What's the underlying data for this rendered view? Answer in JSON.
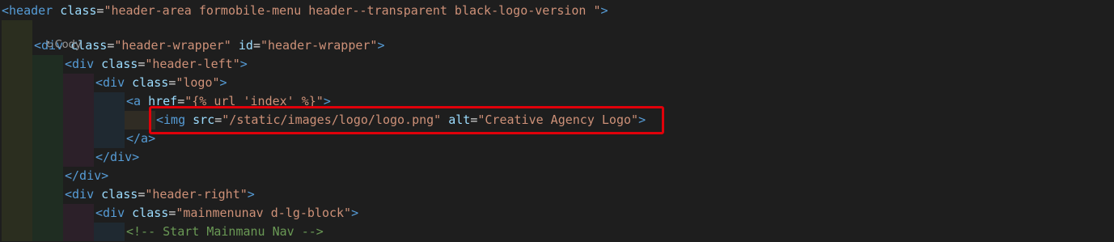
{
  "editor": {
    "code_lens": {
      "icon": "git-author-icon",
      "icon_glyph": "↻",
      "author": "Cody"
    },
    "lines": [
      [
        {
          "t": "tag",
          "v": "<"
        },
        {
          "t": "tag",
          "v": "header"
        },
        {
          "t": "eq",
          "v": " "
        },
        {
          "t": "attr",
          "v": "class"
        },
        {
          "t": "eq",
          "v": "="
        },
        {
          "t": "str",
          "v": "\"header-area formobile-menu header--transparent black-logo-version \""
        },
        {
          "t": "tag",
          "v": ">"
        }
      ],
      [
        {
          "t": "tag",
          "v": "<div"
        },
        {
          "t": "eq",
          "v": " "
        },
        {
          "t": "attr",
          "v": "class"
        },
        {
          "t": "eq",
          "v": "="
        },
        {
          "t": "str",
          "v": "\"header-wrapper\""
        },
        {
          "t": "eq",
          "v": " "
        },
        {
          "t": "attr",
          "v": "id"
        },
        {
          "t": "eq",
          "v": "="
        },
        {
          "t": "str",
          "v": "\"header-wrapper\""
        },
        {
          "t": "tag",
          "v": ">"
        }
      ],
      [
        {
          "t": "tag",
          "v": "<div"
        },
        {
          "t": "eq",
          "v": " "
        },
        {
          "t": "attr",
          "v": "class"
        },
        {
          "t": "eq",
          "v": "="
        },
        {
          "t": "str",
          "v": "\"header-left\""
        },
        {
          "t": "tag",
          "v": ">"
        }
      ],
      [
        {
          "t": "tag",
          "v": "<div"
        },
        {
          "t": "eq",
          "v": " "
        },
        {
          "t": "attr",
          "v": "class"
        },
        {
          "t": "eq",
          "v": "="
        },
        {
          "t": "str",
          "v": "\"logo\""
        },
        {
          "t": "tag",
          "v": ">"
        }
      ],
      [
        {
          "t": "tag",
          "v": "<a"
        },
        {
          "t": "eq",
          "v": " "
        },
        {
          "t": "attr",
          "v": "href"
        },
        {
          "t": "eq",
          "v": "="
        },
        {
          "t": "str",
          "v": "\"{% url 'index' %}\""
        },
        {
          "t": "tag",
          "v": ">"
        }
      ],
      [
        {
          "t": "tag",
          "v": "<img"
        },
        {
          "t": "eq",
          "v": " "
        },
        {
          "t": "attr",
          "v": "src"
        },
        {
          "t": "eq",
          "v": "="
        },
        {
          "t": "str",
          "v": "\"/static/images/logo/logo.png\""
        },
        {
          "t": "eq",
          "v": " "
        },
        {
          "t": "attr",
          "v": "alt"
        },
        {
          "t": "eq",
          "v": "="
        },
        {
          "t": "str",
          "v": "\"Creative Agency Logo\""
        },
        {
          "t": "tag",
          "v": ">"
        }
      ],
      [
        {
          "t": "tag",
          "v": "</a>"
        }
      ],
      [
        {
          "t": "tag",
          "v": "</div>"
        }
      ],
      [
        {
          "t": "tag",
          "v": "</div>"
        }
      ],
      [
        {
          "t": "tag",
          "v": "<div"
        },
        {
          "t": "eq",
          "v": " "
        },
        {
          "t": "attr",
          "v": "class"
        },
        {
          "t": "eq",
          "v": "="
        },
        {
          "t": "str",
          "v": "\"header-right\""
        },
        {
          "t": "tag",
          "v": ">"
        }
      ],
      [
        {
          "t": "tag",
          "v": "<div"
        },
        {
          "t": "eq",
          "v": " "
        },
        {
          "t": "attr",
          "v": "class"
        },
        {
          "t": "eq",
          "v": "="
        },
        {
          "t": "str",
          "v": "\"mainmenunav d-lg-block\""
        },
        {
          "t": "tag",
          "v": ">"
        }
      ],
      [
        {
          "t": "comment",
          "v": "<!-- Start Mainmanu Nav -->"
        }
      ]
    ],
    "highlighted_line": 5
  },
  "colors": {
    "background": "#1e1e1e",
    "tag": "#569cd6",
    "attribute": "#9cdcfe",
    "string": "#ce9178",
    "comment": "#6a9955",
    "highlight_border": "#e0000a"
  }
}
